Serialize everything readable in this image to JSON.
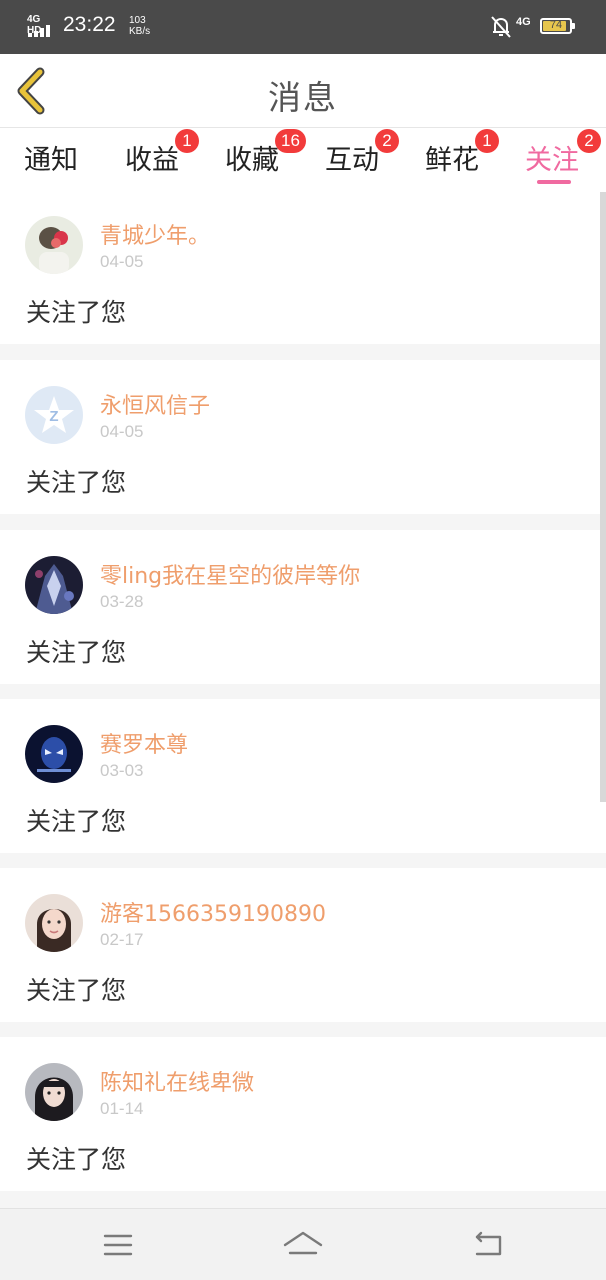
{
  "status_bar": {
    "network_left": "4G HD",
    "time": "23:22",
    "speed_value": "103",
    "speed_unit": "KB/s",
    "network_right": "4G",
    "battery_percent": "74",
    "battery_color": "#e7c64d"
  },
  "header": {
    "title": "消息",
    "back_icon": "chevron-left-icon"
  },
  "tabs": [
    {
      "label": "通知",
      "badge": ""
    },
    {
      "label": "收益",
      "badge": "1"
    },
    {
      "label": "收藏",
      "badge": "16"
    },
    {
      "label": "互动",
      "badge": "2"
    },
    {
      "label": "鲜花",
      "badge": "1"
    },
    {
      "label": "关注",
      "badge": "2",
      "active": true
    }
  ],
  "messages": [
    {
      "username": "青城少年。",
      "date": "04-05",
      "text": "关注了您"
    },
    {
      "username": "永恒风信子",
      "date": "04-05",
      "text": "关注了您"
    },
    {
      "username": "零ling我在星空的彼岸等你",
      "date": "03-28",
      "text": "关注了您"
    },
    {
      "username": "赛罗本尊",
      "date": "03-03",
      "text": "关注了您"
    },
    {
      "username": "游客1566359190890",
      "date": "02-17",
      "text": "关注了您"
    },
    {
      "username": "陈知礼在线卑微",
      "date": "01-14",
      "text": "关注了您"
    }
  ],
  "colors": {
    "accent": "#f06aa0",
    "username": "#ef9e6c",
    "badge": "#f23b3b",
    "back_icon": "#e8c33a"
  },
  "navbar": {
    "icons": [
      "menu-icon",
      "home-icon",
      "back-icon"
    ]
  }
}
